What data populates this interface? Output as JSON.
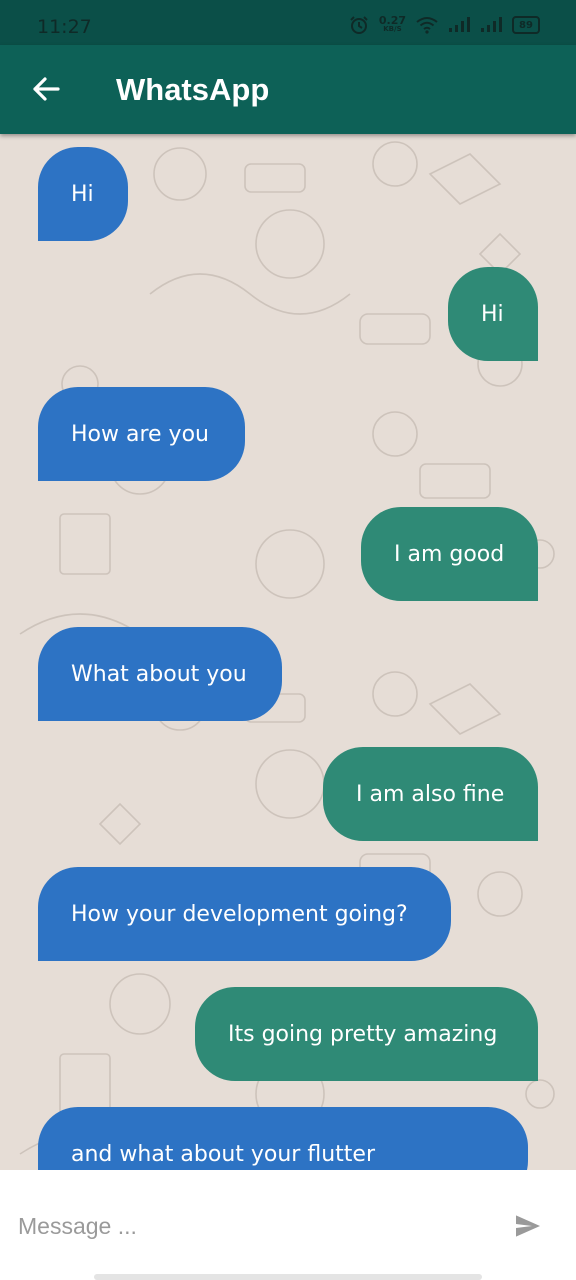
{
  "status_bar": {
    "time": "11:27",
    "speed_value": "0.27",
    "speed_unit": "KB/S",
    "battery": "89",
    "icons": [
      "alarm-icon",
      "wifi-icon",
      "signal-icon",
      "signal-icon",
      "battery-icon"
    ]
  },
  "app_bar": {
    "title": "WhatsApp",
    "back_icon": "arrow-left-icon"
  },
  "messages": [
    {
      "text": "Hi",
      "side": "incoming"
    },
    {
      "text": "Hi",
      "side": "outgoing"
    },
    {
      "text": "How are you",
      "side": "incoming"
    },
    {
      "text": "I am good",
      "side": "outgoing"
    },
    {
      "text": "What about you",
      "side": "incoming"
    },
    {
      "text": "I am also fine",
      "side": "outgoing"
    },
    {
      "text": "How your development going?",
      "side": "incoming"
    },
    {
      "text": "Its going pretty amazing",
      "side": "outgoing"
    },
    {
      "text": "and what about your flutter",
      "side": "incoming"
    }
  ],
  "input": {
    "placeholder": "Message ...",
    "value": "",
    "send_icon": "send-icon"
  },
  "colors": {
    "status_bar": "#0b4f48",
    "app_bar": "#0d6157",
    "incoming_bubble": "#2d73c4",
    "outgoing_bubble": "#2f8a76",
    "chat_background": "#e6ddd6"
  }
}
